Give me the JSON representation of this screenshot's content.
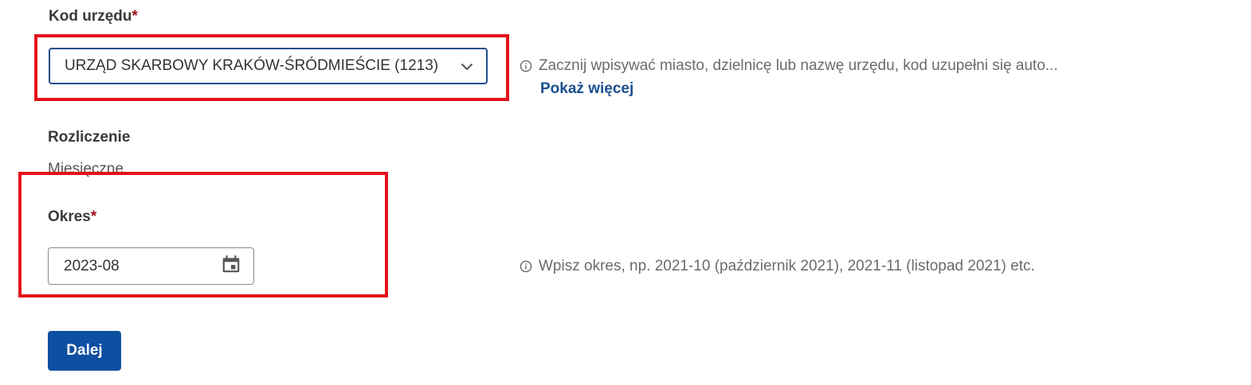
{
  "office_code": {
    "label": "Kod urzędu",
    "required_mark": "*",
    "selected_value": "URZĄD SKARBOWY KRAKÓW-ŚRÓDMIEŚCIE (1213)",
    "hint": "Zacznij wpisywać miasto, dzielnicę lub nazwę urzędu, kod uzupełni się auto...",
    "show_more_label": "Pokaż więcej"
  },
  "settlement": {
    "label": "Rozliczenie",
    "value": "Miesięczne"
  },
  "period": {
    "label": "Okres",
    "required_mark": "*",
    "value": "2023-08",
    "hint": "Wpisz okres, np. 2021-10 (październik 2021), 2021-11 (listopad 2021) etc."
  },
  "actions": {
    "next_label": "Dalej"
  },
  "colors": {
    "primary": "#0d4fa0",
    "link": "#1a4f8f",
    "required": "#a0121c",
    "highlight": "#e3121b"
  }
}
